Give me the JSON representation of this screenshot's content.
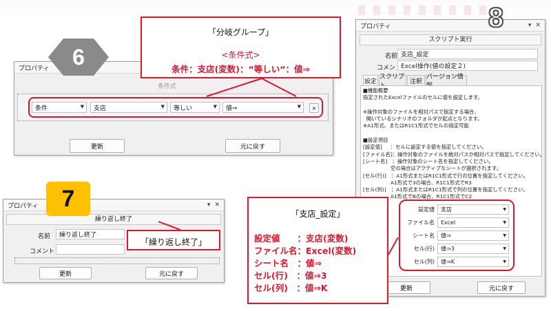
{
  "win6": {
    "title": "プロパティ",
    "faded_label": "条件式",
    "cond_select": "条件",
    "branch_select": "支店",
    "op_select": "等しい",
    "value_select": "値⇒",
    "remove_btn": "×",
    "update_btn": "更新",
    "revert_btn": "元に戻す"
  },
  "badge6": "6",
  "callout6": {
    "title": "「分岐グループ」",
    "subtitle": "<条件式>",
    "body": "条件：支店(変数)：“等しい“：値⇒"
  },
  "win7": {
    "title": "プロパティ",
    "header": "繰り返し終了",
    "name_label": "名前",
    "name_value": "繰り返し終了",
    "comment_label": "コメント",
    "update_btn": "更新",
    "revert_btn": "元に戻す"
  },
  "badge7": "7",
  "callout7": {
    "text": "「繰り返し終了」"
  },
  "win8": {
    "title": "プロパティ",
    "header": "スクリプト実行",
    "name_label": "名前",
    "name_value": "支店_設定",
    "comment_label": "コメント",
    "comment_value": "Excel操作(値の設定２)",
    "tabs": [
      "設定",
      "スクリプト",
      "注釈",
      "バージョン情報"
    ],
    "desc": [
      "■機能概要",
      "指定されたExcelファイルのセルに値を設定します。",
      "",
      "※操作対象のファイルを相対パスで指定する場合、",
      "  開いているシナリオのフォルダが起点となります。",
      "※A1形式、またはR1C1形式でセルの指定可能",
      "",
      "■設定項目",
      "[設定値]     ：セルに設定する値を指定してください。",
      "[ファイル名]：操作対象のファイルを絶対パスか相対パスで指定してください。",
      "[シート名]   ：操作対象のシート名を指定してください。",
      "                 空の場合はアクティブなシートが選択されます。",
      "[セル(行)]   ：A1形式またはR1C1形式で行の位置を指定してください。",
      "                 A1形式で3の場合、R1C1形式でR3",
      "[セル(列)]   ：A1形式またはR1C1形式で列の位置を指定してください。",
      "                 A1形式でBの場合、R1C1形式でC2"
    ],
    "fields": [
      {
        "label": "設定値",
        "value": "支店"
      },
      {
        "label": "ファイル名",
        "value": "Excel"
      },
      {
        "label": "シート名",
        "value": "値⇒"
      },
      {
        "label": "セル(行)",
        "value": "値⇒3"
      },
      {
        "label": "セル(列)",
        "value": "値⇒K"
      }
    ],
    "update_btn": "更新",
    "revert_btn": "元に戻す"
  },
  "badge8": "8",
  "callout8": {
    "title": "「支店_設定」",
    "lines": [
      "設定値　　：支店(変数)",
      "ファイル名：Excel(変数)",
      "シート名　：値⇒",
      "セル(行)　：値⇒3",
      "セル(列)　：値⇒K"
    ]
  },
  "colors": {
    "callout_red": "#e0142a",
    "badge_gray": "#8a8a8a",
    "badge_yellow": "#ffc000"
  }
}
